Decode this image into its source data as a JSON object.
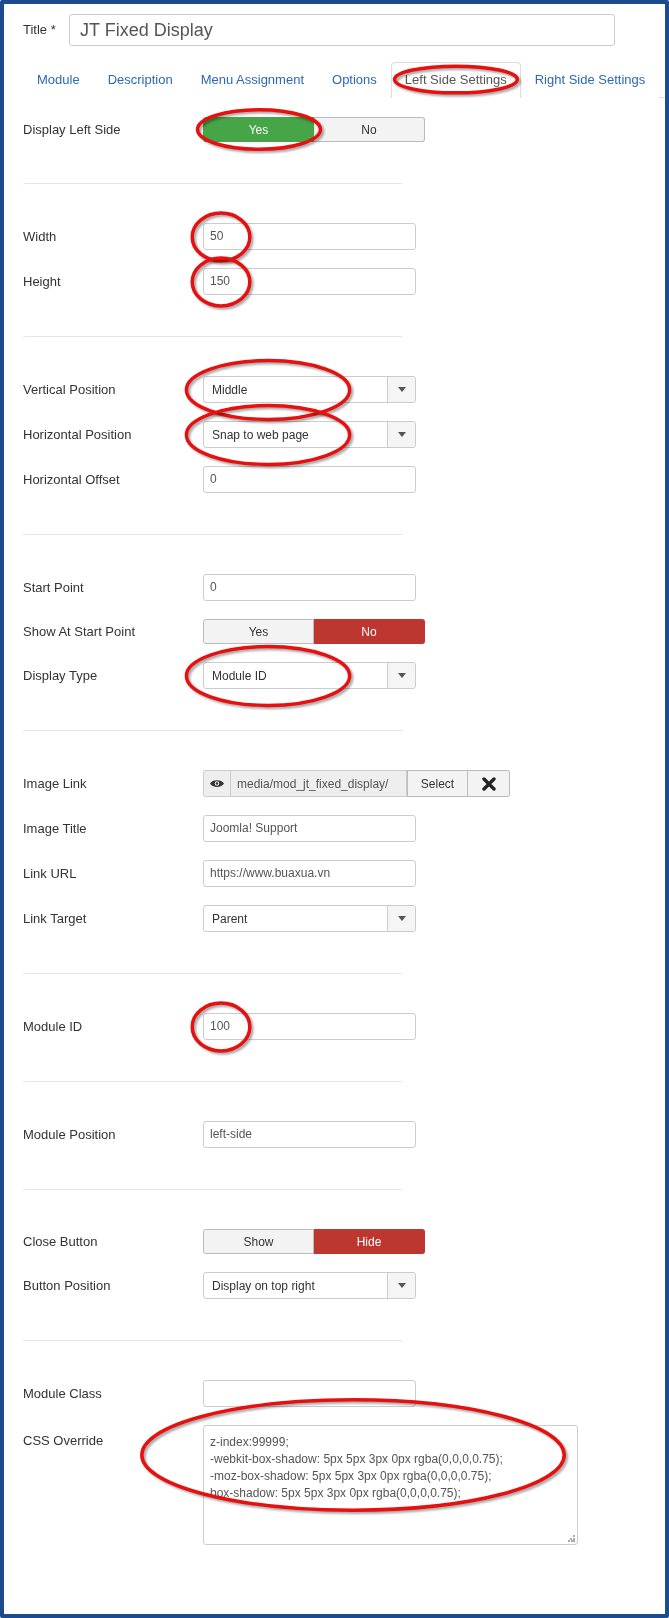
{
  "title_field": {
    "label": "Title *",
    "value": "JT Fixed Display"
  },
  "tabs": [
    {
      "label": "Module",
      "selected": false,
      "circled": false
    },
    {
      "label": "Description",
      "selected": false,
      "circled": false
    },
    {
      "label": "Menu Assignment",
      "selected": false,
      "circled": false
    },
    {
      "label": "Options",
      "selected": false,
      "circled": false
    },
    {
      "label": "Left Side Settings",
      "selected": true,
      "circled": true
    },
    {
      "label": "Right Side Settings",
      "selected": false,
      "circled": false
    }
  ],
  "sections": [
    {
      "fields": [
        {
          "label": "Display Left Side",
          "kind": "toggle",
          "options": [
            {
              "label": "Yes",
              "selected": true,
              "color": "#46a546",
              "circled": true
            },
            {
              "label": "No",
              "selected": false,
              "circled": false
            }
          ]
        }
      ]
    },
    {
      "fields": [
        {
          "label": "Width",
          "kind": "text",
          "value": "50",
          "circled": true
        },
        {
          "label": "Height",
          "kind": "text",
          "value": "150",
          "circled": true
        }
      ]
    },
    {
      "fields": [
        {
          "label": "Vertical Position",
          "kind": "select",
          "value": "Middle",
          "circled": true
        },
        {
          "label": "Horizontal Position",
          "kind": "select",
          "value": "Snap to web page",
          "circled": true
        },
        {
          "label": "Horizontal Offset",
          "kind": "text",
          "value": "0",
          "circled": false
        }
      ]
    },
    {
      "fields": [
        {
          "label": "Start Point",
          "kind": "text",
          "value": "0",
          "circled": false
        },
        {
          "label": "Show At Start Point",
          "kind": "toggle",
          "options": [
            {
              "label": "Yes",
              "selected": false,
              "circled": false
            },
            {
              "label": "No",
              "selected": true,
              "color": "#bd362f",
              "circled": false
            }
          ]
        },
        {
          "label": "Display Type",
          "kind": "select",
          "value": "Module ID",
          "circled": true
        }
      ]
    },
    {
      "fields": [
        {
          "label": "Image Link",
          "kind": "media",
          "value": "media/mod_jt_fixed_display/",
          "button": "Select",
          "circled": false
        },
        {
          "label": "Image Title",
          "kind": "text",
          "value": "Joomla! Support",
          "circled": false
        },
        {
          "label": "Link URL",
          "kind": "text",
          "value": "https://www.buaxua.vn",
          "circled": false
        },
        {
          "label": "Link Target",
          "kind": "select",
          "value": "Parent",
          "circled": false
        }
      ]
    },
    {
      "fields": [
        {
          "label": "Module ID",
          "kind": "text",
          "value": "100",
          "circled": true
        }
      ]
    },
    {
      "fields": [
        {
          "label": "Module Position",
          "kind": "text",
          "value": "left-side",
          "circled": false
        }
      ]
    },
    {
      "fields": [
        {
          "label": "Close Button",
          "kind": "toggle",
          "options": [
            {
              "label": "Show",
              "selected": false,
              "circled": false
            },
            {
              "label": "Hide",
              "selected": true,
              "color": "#bd362f",
              "circled": false
            }
          ]
        },
        {
          "label": "Button Position",
          "kind": "select",
          "value": "Display on top right",
          "circled": false
        }
      ]
    },
    {
      "fields": [
        {
          "label": "Module Class",
          "kind": "text",
          "circled": false
        },
        {
          "label": "CSS Override",
          "kind": "textarea",
          "circled": true,
          "lines": [
            "z-index:99999;",
            "-webkit-box-shadow: 5px 5px 3px 0px rgba(0,0,0,0.75);",
            "-moz-box-shadow: 5px 5px 3px 0px rgba(0,0,0,0.75);",
            "box-shadow: 5px 5px 3px 0px rgba(0,0,0,0.75);"
          ]
        }
      ]
    }
  ]
}
